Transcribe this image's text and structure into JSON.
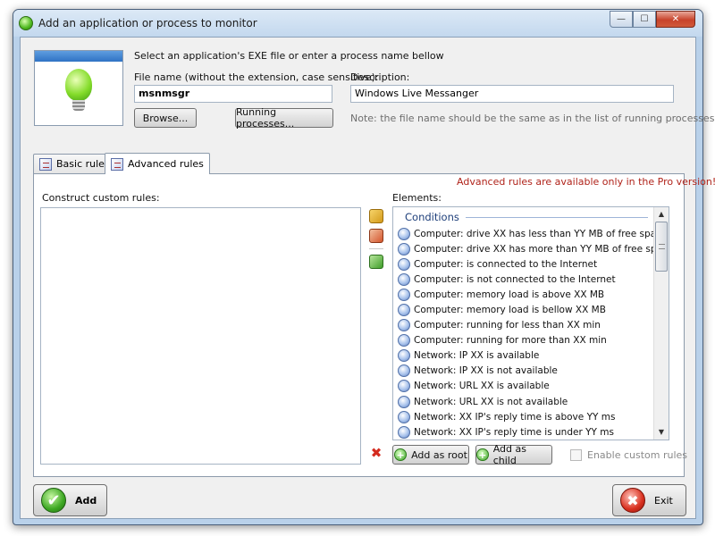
{
  "window": {
    "title": "Add an application or process to monitor",
    "icon": "green-bulb-icon"
  },
  "header": {
    "instruction": "Select an application's EXE file or enter a process name bellow",
    "filename_label": "File name (without the extension, case sensitive):",
    "filename_value": "msnmsgr",
    "description_label": "Description:",
    "description_value": "Windows Live Messanger",
    "browse_label": "Browse...",
    "running_label": "Running processes...",
    "note": "Note: the file name should be the same as in the list of running processes!"
  },
  "tabs": [
    {
      "label": "Basic rules",
      "active": false
    },
    {
      "label": "Advanced rules",
      "active": true
    }
  ],
  "advanced": {
    "pro_note": "Advanced rules are available only in the Pro version!",
    "construct_label": "Construct custom rules:",
    "elements_label": "Elements:",
    "group_title": "Conditions",
    "conditions": [
      "Computer: drive XX has less than YY MB of free space",
      "Computer: drive XX has more than YY MB of free space",
      "Computer: is connected to the Internet",
      "Computer: is not connected to the Internet",
      "Computer: memory load is above XX MB",
      "Computer: memory load is bellow XX MB",
      "Computer: running for less than XX min",
      "Computer: running for more than XX min",
      "Network: IP XX is available",
      "Network: IP XX is not available",
      "Network: URL XX is available",
      "Network: URL XX is not available",
      "Network: XX IP's reply time is above YY ms",
      "Network: XX IP's reply time is under YY ms"
    ],
    "add_root_label": "Add as root",
    "add_child_label": "Add as child",
    "enable_custom_label": "Enable custom rules",
    "enable_custom_checked": false
  },
  "footer": {
    "add_label": "Add",
    "exit_label": "Exit"
  },
  "colors": {
    "pro_note": "#b0231a",
    "group_title": "#1e3f7a",
    "frame": "#b9d1ea"
  }
}
